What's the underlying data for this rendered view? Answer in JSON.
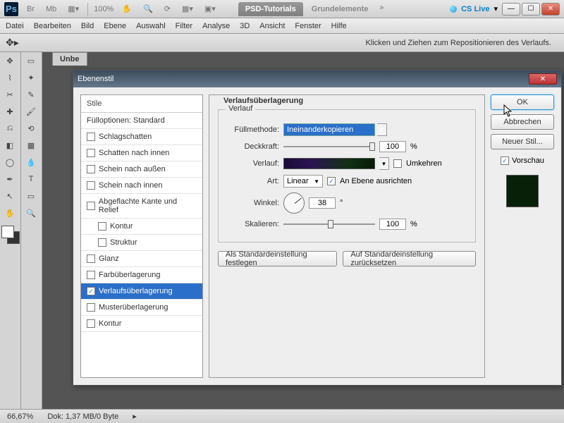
{
  "app_bar": {
    "zoom": "100%",
    "doc_tab_active": "PSD-Tutorials",
    "doc_tab_inactive": "Grundelemente",
    "cs_live": "CS Live"
  },
  "menu": [
    "Datei",
    "Bearbeiten",
    "Bild",
    "Ebene",
    "Auswahl",
    "Filter",
    "Analyse",
    "3D",
    "Ansicht",
    "Fenster",
    "Hilfe"
  ],
  "options_hint": "Klicken und Ziehen zum Repositionieren des Verlaufs.",
  "file_tab": "Unbe",
  "status": {
    "zoom": "66,67%",
    "doc": "Dok: 1,37 MB/0 Byte"
  },
  "dialog": {
    "title": "Ebenenstil",
    "styles_header": "Stile",
    "fill_options": "Fülloptionen: Standard",
    "items": [
      {
        "label": "Schlagschatten",
        "checked": false
      },
      {
        "label": "Schatten nach innen",
        "checked": false
      },
      {
        "label": "Schein nach außen",
        "checked": false
      },
      {
        "label": "Schein nach innen",
        "checked": false
      },
      {
        "label": "Abgeflachte Kante und Relief",
        "checked": false
      },
      {
        "label": "Kontur",
        "checked": false,
        "sub": true
      },
      {
        "label": "Struktur",
        "checked": false,
        "sub": true
      },
      {
        "label": "Glanz",
        "checked": false
      },
      {
        "label": "Farbüberlagerung",
        "checked": false
      },
      {
        "label": "Verlaufsüberlagerung",
        "checked": true,
        "selected": true
      },
      {
        "label": "Musterüberlagerung",
        "checked": false
      },
      {
        "label": "Kontur",
        "checked": false
      }
    ],
    "group_title": "Verlaufsüberlagerung",
    "inner_title": "Verlauf",
    "labels": {
      "blend": "Füllmethode:",
      "opacity": "Deckkraft:",
      "gradient": "Verlauf:",
      "style": "Art:",
      "angle": "Winkel:",
      "scale": "Skalieren:",
      "reverse": "Umkehren",
      "align": "An Ebene ausrichten",
      "pct": "%",
      "deg": "°"
    },
    "values": {
      "blend": "Ineinanderkopieren",
      "opacity": "100",
      "style": "Linear",
      "angle": "38",
      "scale": "100",
      "align_checked": true,
      "reverse_checked": false
    },
    "buttons": {
      "make_default": "Als Standardeinstellung festlegen",
      "reset_default": "Auf Standardeinstellung zurücksetzen",
      "ok": "OK",
      "cancel": "Abbrechen",
      "new_style": "Neuer Stil...",
      "preview": "Vorschau"
    }
  }
}
